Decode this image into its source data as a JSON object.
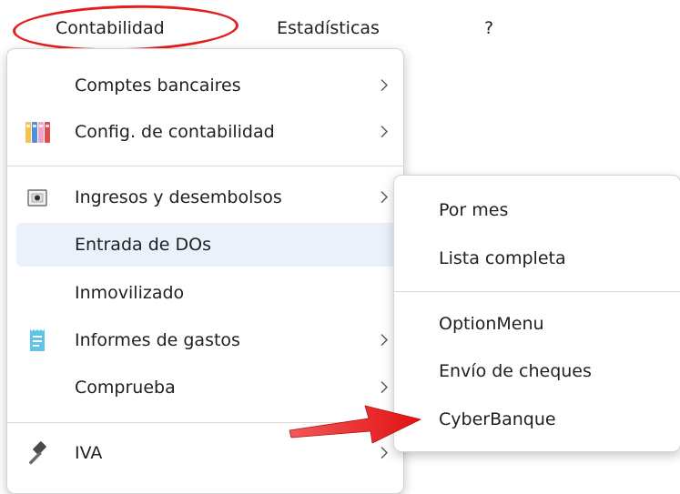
{
  "menubar": {
    "items": [
      {
        "label": "Contabilidad"
      },
      {
        "label": "Estadísticas"
      },
      {
        "label": "?"
      }
    ]
  },
  "menu": {
    "items": [
      {
        "label": "Comptes bancaires",
        "icon": "",
        "submenu": true
      },
      {
        "label": "Config. de contabilidad",
        "icon": "binders-icon",
        "submenu": true
      },
      {
        "label": "Ingresos y desembolsos",
        "icon": "cash-register-icon",
        "submenu": true
      },
      {
        "label": "Entrada de DOs",
        "icon": "",
        "submenu": false,
        "highlighted": true
      },
      {
        "label": "Inmovilizado",
        "icon": "",
        "submenu": false
      },
      {
        "label": "Informes de gastos",
        "icon": "receipt-icon",
        "submenu": true
      },
      {
        "label": "Comprueba",
        "icon": "",
        "submenu": true
      },
      {
        "label": "IVA",
        "icon": "gavel-icon",
        "submenu": true
      }
    ]
  },
  "submenu": {
    "items": [
      {
        "label": "Por mes"
      },
      {
        "label": "Lista completa"
      },
      {
        "label": "OptionMenu"
      },
      {
        "label": "Envío de cheques"
      },
      {
        "label": "CyberBanque"
      }
    ]
  },
  "colors": {
    "annotation_red": "#e31e1e",
    "highlight_bg": "#eaf1fb"
  }
}
